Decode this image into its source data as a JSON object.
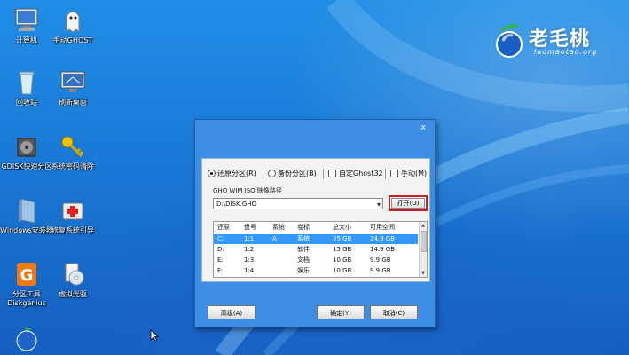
{
  "desktop": {
    "icons": [
      {
        "label": "计算机",
        "icon": "computer-icon"
      },
      {
        "label": "手动GHOST",
        "icon": "ghost-icon"
      },
      {
        "label": "回收站",
        "icon": "recycle-bin-icon"
      },
      {
        "label": "刷新桌面",
        "icon": "refresh-desktop-icon"
      },
      {
        "label": "GDISK快速分区",
        "icon": "gdisk-icon"
      },
      {
        "label": "系统密码清除",
        "icon": "key-icon"
      },
      {
        "label": "Windows安装器",
        "icon": "windows-installer-icon"
      },
      {
        "label": "修复系统引导",
        "icon": "repair-boot-icon"
      },
      {
        "label": "分区工具Diskgenius",
        "icon": "diskgenius-icon"
      },
      {
        "label": "虚拟光驱",
        "icon": "virtual-drive-icon"
      }
    ]
  },
  "logo": {
    "name": "老毛桃",
    "url": "laomaotao.org"
  },
  "dialog": {
    "close": "x",
    "options": {
      "restore": "还原分区(R)",
      "backup": "备份分区(B)",
      "custom_ghost": "自定Ghost32",
      "manual": "手动(M)"
    },
    "path_label": "GHO WIM ISO 映像路径",
    "path_value": "D:\\DISK.GHO",
    "open_button": "打开(O)",
    "table": {
      "headers": [
        "还原",
        "盘号",
        "系统",
        "卷标",
        "总大小",
        "可用空间"
      ],
      "rows": [
        [
          "C:",
          "1:1",
          "A",
          "系统",
          "25 GB",
          "24.9 GB"
        ],
        [
          "D:",
          "1:2",
          "",
          "软件",
          "15 GB",
          "14.9 GB"
        ],
        [
          "E:",
          "1:3",
          "",
          "文档",
          "10 GB",
          "9.9 GB"
        ],
        [
          "F:",
          "1:4",
          "",
          "娱乐",
          "10 GB",
          "9.9 GB"
        ]
      ]
    },
    "buttons": {
      "advanced": "高级(A)",
      "ok": "确定(Y)",
      "cancel": "取消(C)"
    }
  }
}
